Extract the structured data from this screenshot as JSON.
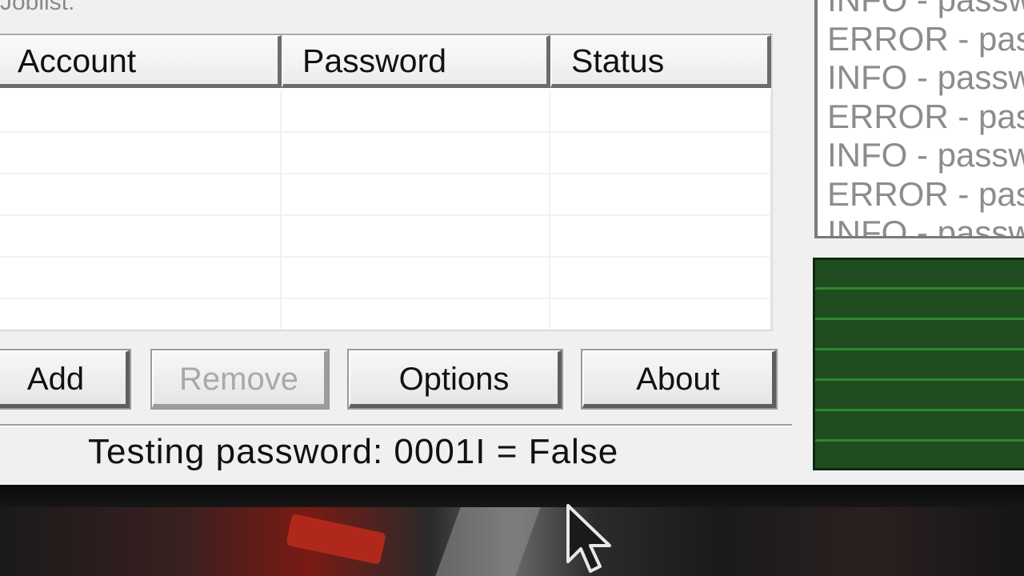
{
  "joblist": {
    "label": "Joblist:",
    "columns": [
      "Account",
      "Password",
      "Status"
    ],
    "rows": [
      [
        "",
        "",
        ""
      ],
      [
        "",
        "",
        ""
      ],
      [
        "",
        "",
        ""
      ],
      [
        "",
        "",
        ""
      ],
      [
        "",
        "",
        ""
      ],
      [
        "",
        "",
        ""
      ]
    ]
  },
  "buttons": {
    "add": "Add",
    "remove": "Remove",
    "options": "Options",
    "about": "About"
  },
  "status": {
    "text": "Testing password: 0001I = False"
  },
  "log": {
    "lines": [
      "INFO - password",
      "ERROR - password",
      "INFO - password",
      "ERROR - password",
      "INFO - password",
      "ERROR - password",
      "INFO - password"
    ]
  },
  "colors": {
    "graph_bg": "#1f4d1f",
    "graph_line": "#2e8a2e",
    "window_bg": "#f0f0f0"
  }
}
